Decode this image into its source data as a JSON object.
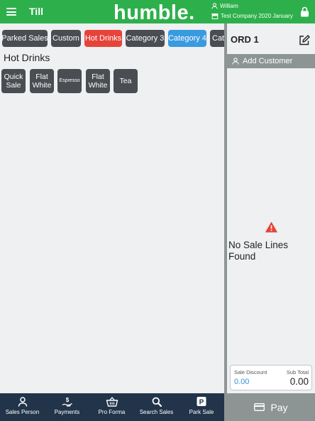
{
  "header": {
    "title": "Till",
    "brand": "humble.",
    "user": "William",
    "company": "Test Company 2020 January"
  },
  "categories": [
    {
      "label": "Parked Sales",
      "color": "#4a4d52"
    },
    {
      "label": "Custom",
      "color": "#4a4d52"
    },
    {
      "label": "Hot Drinks",
      "color": "#e6443a"
    },
    {
      "label": "Category 3",
      "color": "#4a4d52"
    },
    {
      "label": "Category 4",
      "color": "#3a9ae0"
    },
    {
      "label": "Cat",
      "color": "#4a4d52"
    }
  ],
  "section_title": "Hot Drinks",
  "products": [
    {
      "label": "Quick Sale"
    },
    {
      "label": "Flat White"
    },
    {
      "label": "Espresso"
    },
    {
      "label": "Flat White"
    },
    {
      "label": "Tea"
    }
  ],
  "order": {
    "id": "ORD 1",
    "add_customer_label": "Add Customer",
    "empty_message": "No Sale Lines Found",
    "sale_discount_label": "Sale Discount",
    "sale_discount_value": "0.00",
    "subtotal_label": "Sub Total",
    "subtotal_value": "0.00",
    "pay_label": "Pay"
  },
  "bottom_nav": [
    {
      "label": "Sales Person",
      "icon": "person-icon"
    },
    {
      "label": "Payments",
      "icon": "payments-icon"
    },
    {
      "label": "Pro Forma",
      "icon": "basket-icon"
    },
    {
      "label": "Search Sales",
      "icon": "search-icon"
    },
    {
      "label": "Park Sale",
      "icon": "parking-icon"
    }
  ],
  "colors": {
    "brand_green": "#2db04b",
    "nav_dark": "#223449",
    "panel_grey": "#8c9494",
    "warning_red": "#e6443a"
  }
}
